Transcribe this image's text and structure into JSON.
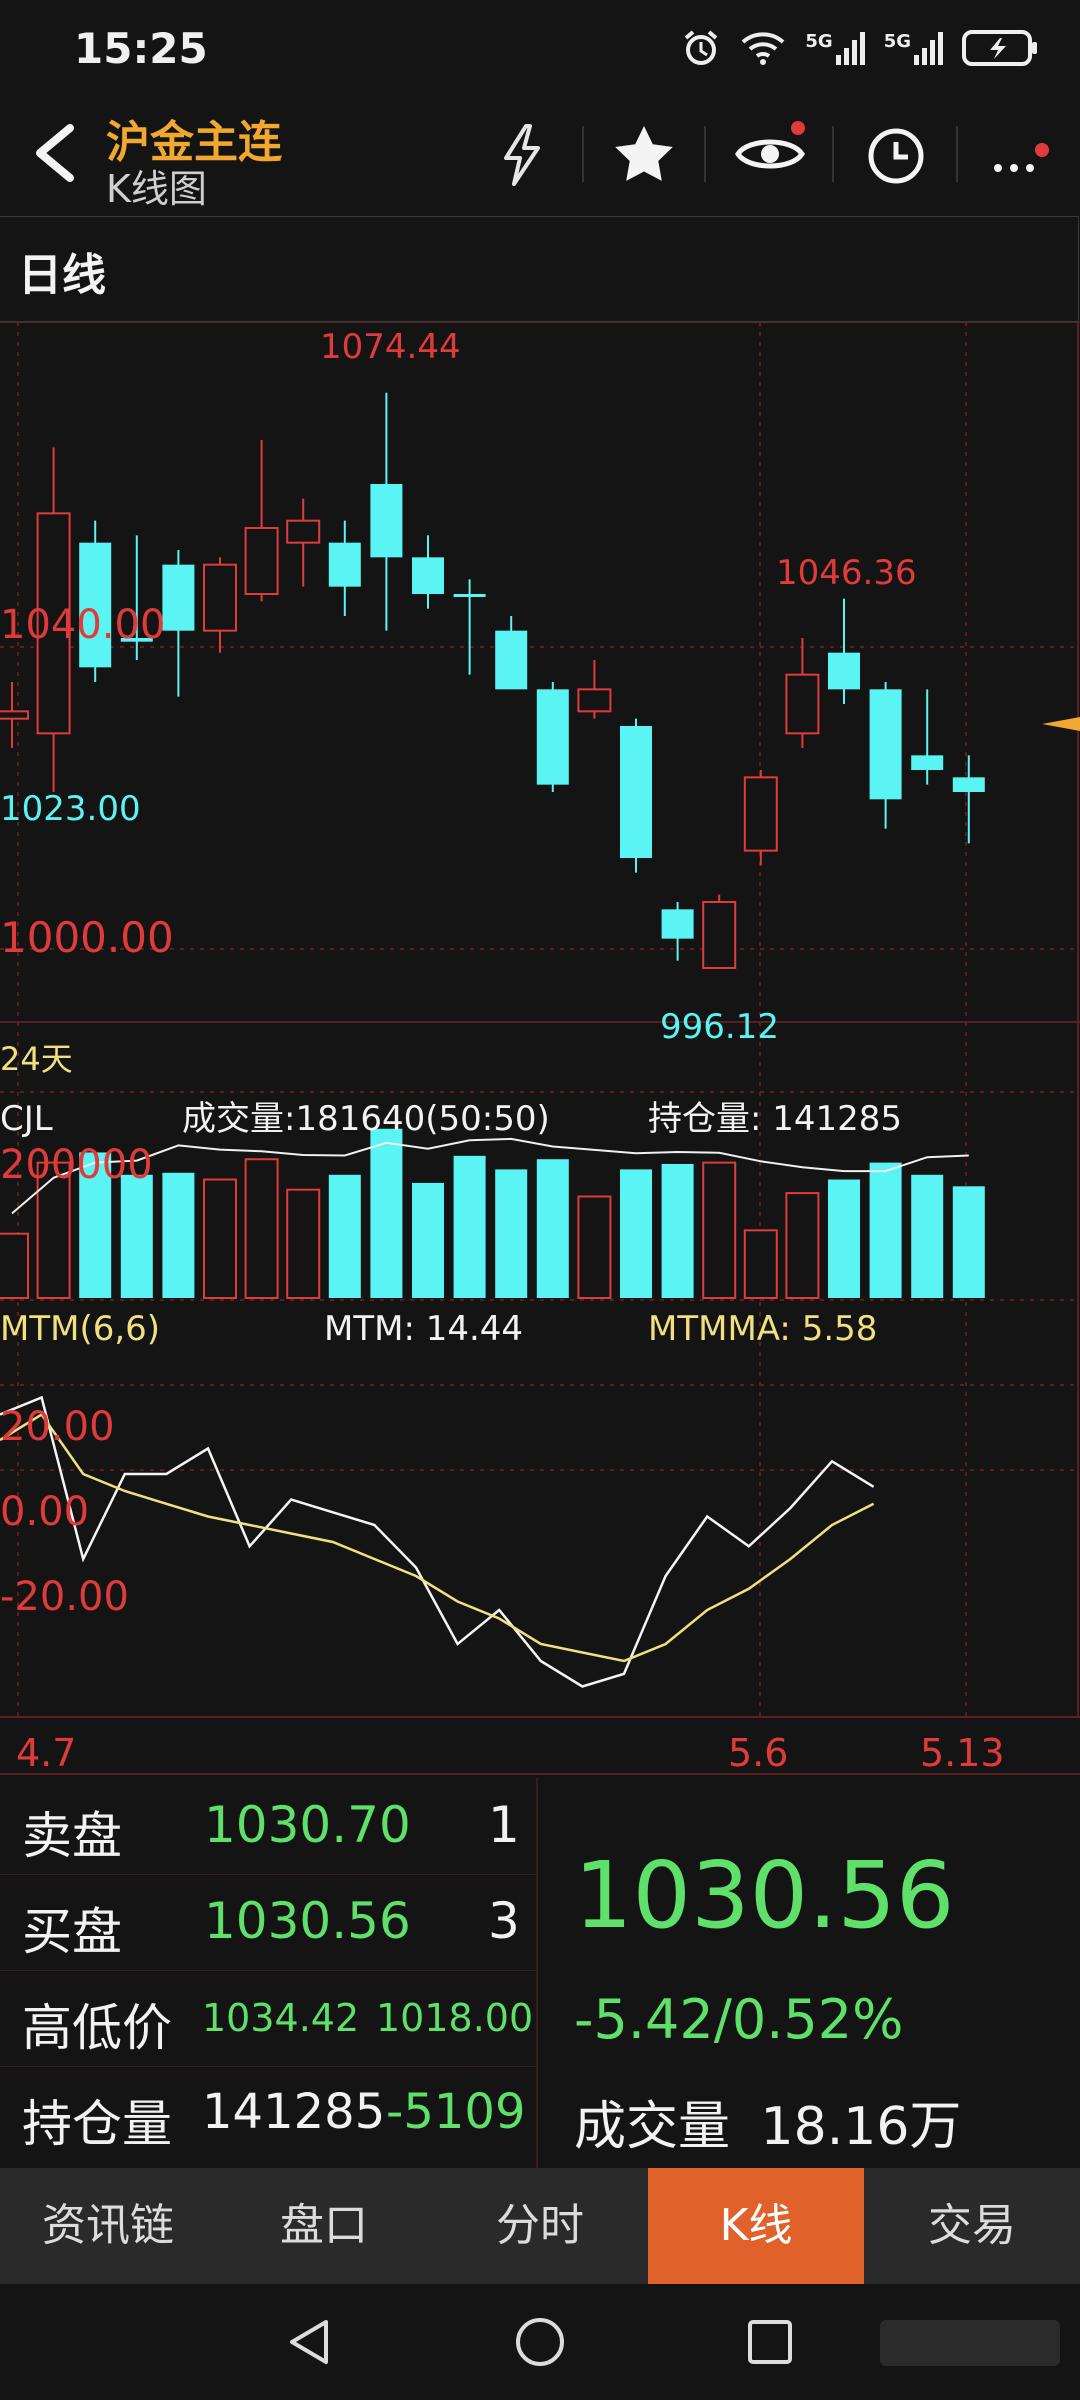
{
  "status": {
    "time": "15:25",
    "net1": "5G",
    "net2": "5G"
  },
  "header": {
    "title": "沪金主连",
    "subtitle": "K线图"
  },
  "period": {
    "label": "日线"
  },
  "chart_data": {
    "type": "candlestick",
    "price_labels": {
      "high": "1074.44",
      "left_mid": "1040.00",
      "left_low": "1023.00",
      "level_1000": "1000.00",
      "low": "996.12",
      "local_high": "1046.36"
    },
    "range_label": "24天",
    "volume_panel": {
      "name": "CJL",
      "volume_text": "成交量:181640(50:50)",
      "oi_text": "持仓量: 141285",
      "axis_label": "200000"
    },
    "mtm_panel": {
      "name": "MTM(6,6)",
      "mtm_text": "MTM: 14.44",
      "mtmma_text": "MTMMA: 5.58",
      "axis_labels": [
        "20.00",
        "0.00",
        "-20.00"
      ]
    },
    "dates": [
      "4.7",
      "5.6",
      "5.13"
    ],
    "ylim": [
      990,
      1080
    ],
    "candles": [
      {
        "o": 1030,
        "c": 1031,
        "h": 1035,
        "l": 1026
      },
      {
        "o": 1028,
        "c": 1058,
        "h": 1067,
        "l": 1020
      },
      {
        "o": 1054,
        "c": 1037,
        "h": 1057,
        "l": 1035
      },
      {
        "o": 1041,
        "c": 1040.5,
        "h": 1055,
        "l": 1038
      },
      {
        "o": 1051,
        "c": 1042,
        "h": 1053,
        "l": 1033
      },
      {
        "o": 1042,
        "c": 1051,
        "h": 1052,
        "l": 1039
      },
      {
        "o": 1047,
        "c": 1056,
        "h": 1068,
        "l": 1046
      },
      {
        "o": 1054,
        "c": 1057,
        "h": 1060,
        "l": 1048
      },
      {
        "o": 1054,
        "c": 1048,
        "h": 1057,
        "l": 1044
      },
      {
        "o": 1062,
        "c": 1052,
        "h": 1074.44,
        "l": 1042
      },
      {
        "o": 1052,
        "c": 1047,
        "h": 1055,
        "l": 1045
      },
      {
        "o": 1047,
        "c": 1047,
        "h": 1049,
        "l": 1036
      },
      {
        "o": 1042,
        "c": 1034,
        "h": 1044,
        "l": 1036
      },
      {
        "o": 1034,
        "c": 1021,
        "h": 1035,
        "l": 1020
      },
      {
        "o": 1031,
        "c": 1034,
        "h": 1038,
        "l": 1030
      },
      {
        "o": 1029,
        "c": 1011,
        "h": 1030,
        "l": 1009
      },
      {
        "o": 1004,
        "c": 1000,
        "h": 1005,
        "l": 997
      },
      {
        "o": 996,
        "c": 1005,
        "h": 1006,
        "l": 996.12
      },
      {
        "o": 1012,
        "c": 1022,
        "h": 1023,
        "l": 1010
      },
      {
        "o": 1028,
        "c": 1036,
        "h": 1041,
        "l": 1026
      },
      {
        "o": 1039,
        "c": 1034,
        "h": 1046.36,
        "l": 1032
      },
      {
        "o": 1034,
        "c": 1019,
        "h": 1035,
        "l": 1015
      },
      {
        "o": 1025,
        "c": 1023,
        "h": 1034,
        "l": 1021
      },
      {
        "o": 1022,
        "c": 1020,
        "h": 1025,
        "l": 1013
      }
    ],
    "volumes": [
      95000,
      200000,
      215000,
      182000,
      185000,
      175000,
      205000,
      160000,
      182000,
      250000,
      170000,
      210000,
      190000,
      205000,
      150000,
      190000,
      198000,
      200000,
      100000,
      155000,
      175000,
      200000,
      182000,
      165000
    ],
    "mtm": [
      26,
      30,
      -8,
      12,
      12,
      18,
      -5,
      6,
      3,
      0,
      -10,
      -28,
      -20,
      -32,
      -38,
      -35,
      -12,
      2,
      -5,
      4,
      15,
      9
    ],
    "mtmma": [
      20,
      26,
      12,
      8,
      5,
      2,
      0,
      -2,
      -4,
      -8,
      -12,
      -18,
      -22,
      -28,
      -30,
      -32,
      -28,
      -20,
      -15,
      -8,
      0,
      5
    ]
  },
  "quote": {
    "ask_label": "卖盘",
    "ask_price": "1030.70",
    "ask_qty": "1",
    "bid_label": "买盘",
    "bid_price": "1030.56",
    "bid_qty": "3",
    "hl_label": "高低价",
    "high": "1034.42",
    "low": "1018.00",
    "oi_label": "持仓量",
    "oi_value": "141285",
    "oi_change": "-5109",
    "last": "1030.56",
    "change": "-5.42/0.52%",
    "volume_label": "成交量",
    "volume_value": "18.16万"
  },
  "tabs": [
    "资讯链",
    "盘口",
    "分时",
    "K线",
    "交易"
  ],
  "colors": {
    "up": "#e03b3b",
    "down": "#5af4f4",
    "accent": "#f0a830",
    "active_tab": "#e0622a",
    "green": "#5ee06a"
  }
}
